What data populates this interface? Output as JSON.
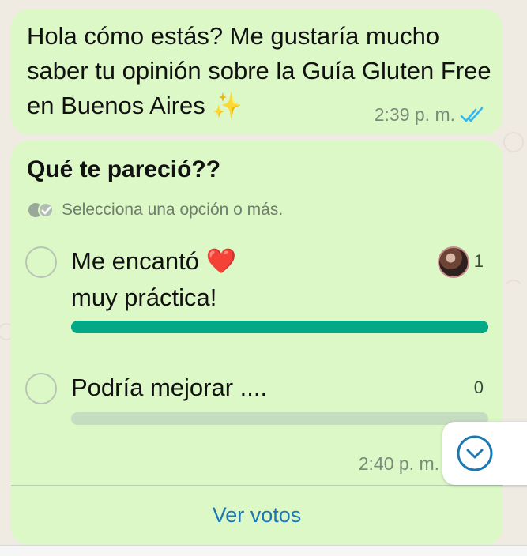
{
  "message1": {
    "text": "Hola cómo estás? Me gustaría mucho saber tu opinión sobre la Guía Gluten Free en Buenos Aires ✨",
    "time": "2:39 p. m.",
    "status_icon": "double-check-read-icon",
    "status_color": "#34b7f1"
  },
  "poll": {
    "title": "Qué te pareció??",
    "hint": "Selecciona una opción o más.",
    "options": [
      {
        "label": "Me encantó ❤️\nmuy práctica!",
        "count": "1",
        "vote_fraction": 1.0,
        "has_voter_avatar": true
      },
      {
        "label": "Podría mejorar ....",
        "count": "0",
        "vote_fraction": 0.0,
        "has_voter_avatar": false
      }
    ],
    "time": "2:40 p. m.",
    "view_votes_label": "Ver votos"
  },
  "colors": {
    "bubble": "#dcf8c6",
    "bar_fill": "#03a884",
    "bar_track": "#c6dcc0",
    "link": "#1c78b4",
    "background": "#efeae2"
  },
  "scroll_button": {
    "icon": "chevron-down-circle-icon"
  }
}
